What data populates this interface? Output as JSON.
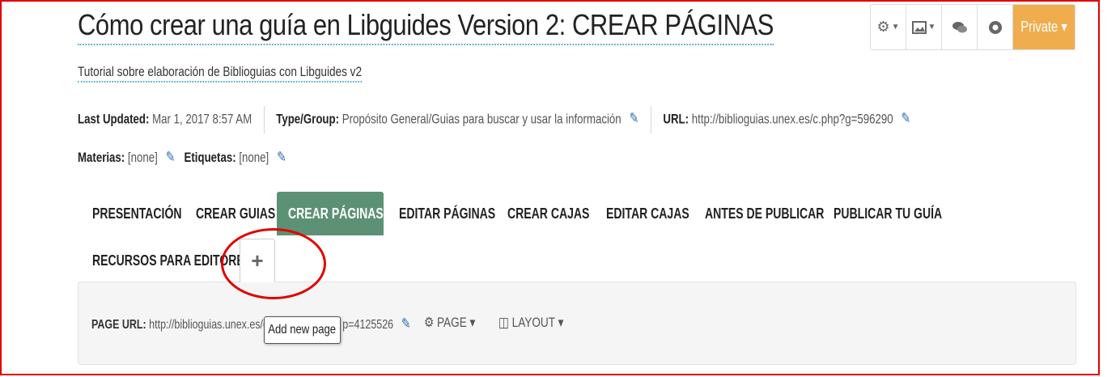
{
  "guide": {
    "title": "Cómo crear una guía en Libguides Version 2: CREAR PÁGINAS",
    "subtitle": "Tutorial sobre elaboración de Biblioguias con Libguides v2"
  },
  "meta": {
    "last_updated_label": "Last Updated:",
    "last_updated_value": "Mar 1, 2017 8:57 AM",
    "type_label": "Type/Group:",
    "type_value": "Propósito General/Guias para buscar y usar la información",
    "url_label": "URL:",
    "url_value": "http://biblioguias.unex.es/c.php?g=596290",
    "materias_label": "Materias:",
    "materias_value": "[none]",
    "etiquetas_label": "Etiquetas:",
    "etiquetas_value": "[none]"
  },
  "toolbar": {
    "gear_icon": "gear-icon",
    "image_icon": "image-icon",
    "comments_icon": "comments-icon",
    "eye_icon": "eye-icon",
    "private_label": "Private ▾",
    "private_color": "#f0ad4e"
  },
  "tabs": [
    {
      "label": "PRESENTACIÓN"
    },
    {
      "label": "CREAR GUIAS"
    },
    {
      "label": "CREAR PÁGINAS",
      "active": true
    },
    {
      "label": "EDITAR PÁGINAS"
    },
    {
      "label": "CREAR CAJAS"
    },
    {
      "label": "EDITAR CAJAS"
    },
    {
      "label": "ANTES DE PUBLICAR"
    },
    {
      "label": "PUBLICAR TU GUÍA"
    },
    {
      "label": "RECURSOS PARA EDITORES"
    }
  ],
  "active_tab_color": "#5c9175",
  "add_tab": {
    "label": "+"
  },
  "page_panel": {
    "url_label": "PAGE URL:",
    "url_prefix": "http://biblioguias.unex.es/c",
    "url_suffix": "p=4125526",
    "page_menu": "PAGE ▾",
    "layout_menu": "LAYOUT ▾"
  },
  "tooltip": {
    "text": "Add new page"
  }
}
